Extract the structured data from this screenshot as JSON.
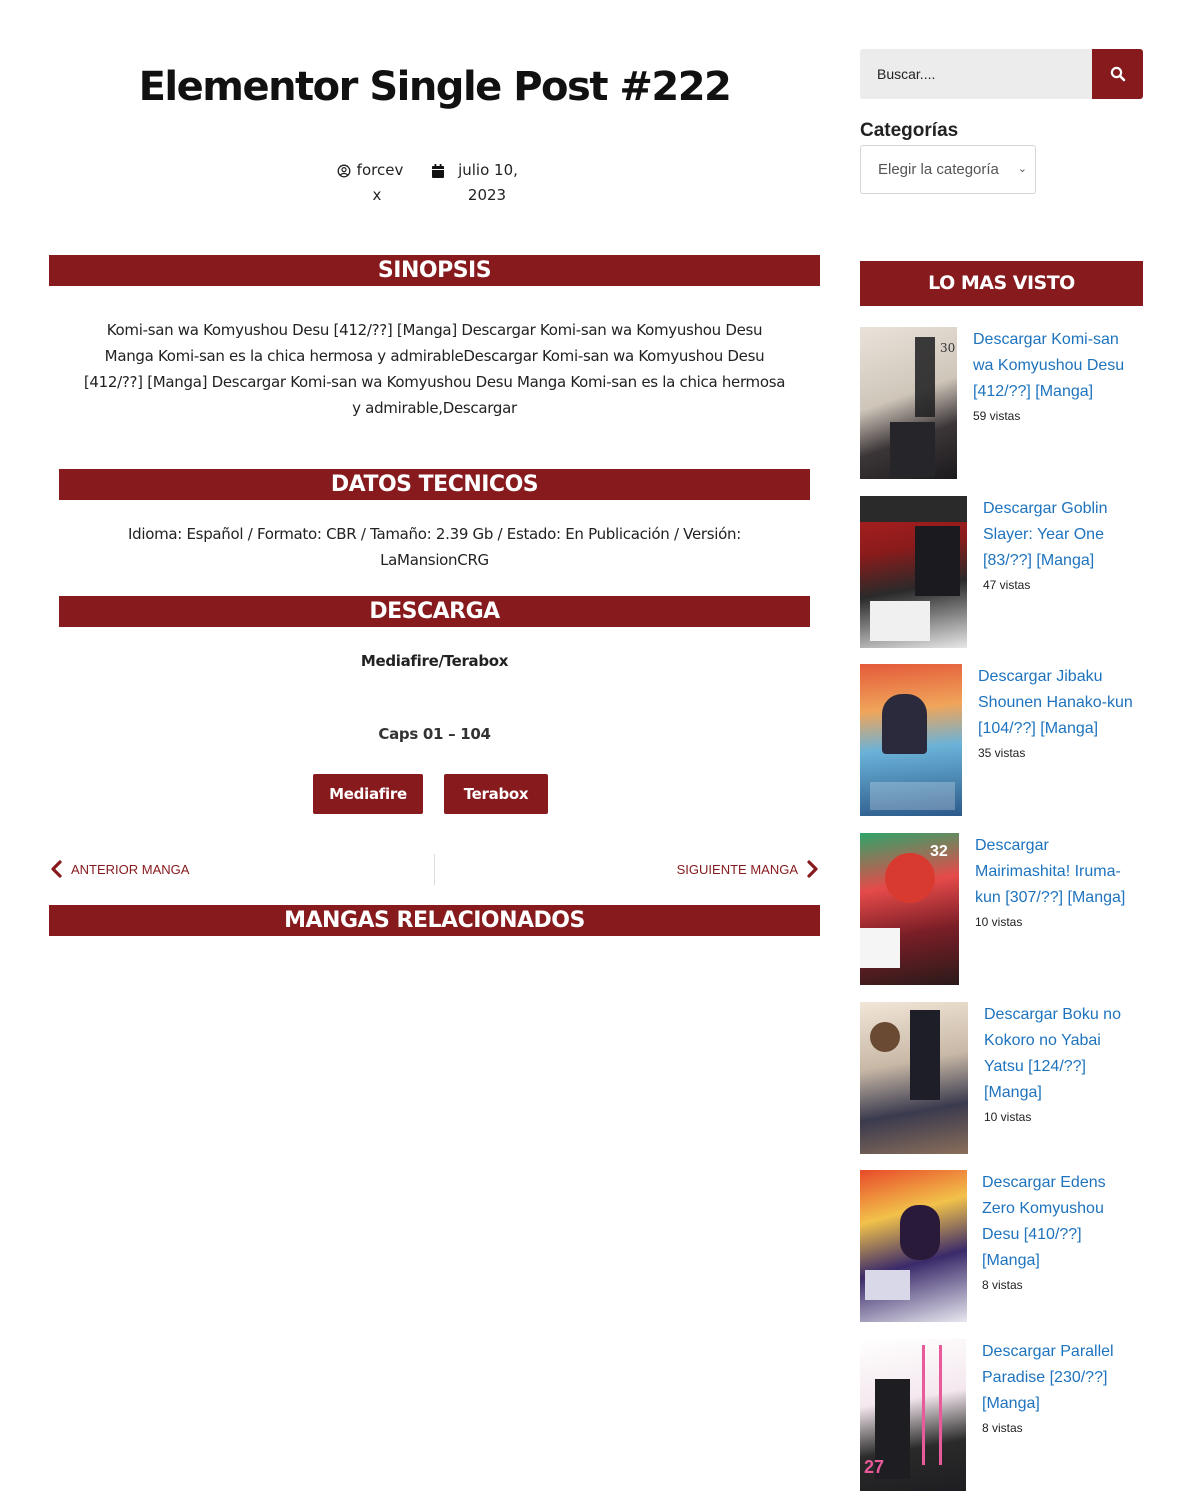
{
  "post": {
    "title": "Elementor Single Post #222",
    "author_line1": "forcev",
    "author_line2": "x",
    "date_line1": "julio 10,",
    "date_line2": "2023"
  },
  "sections": {
    "sinopsis": {
      "heading": "SINOPSIS",
      "lines": [
        "Komi-san wa Komyushou Desu [412/??] [Manga] Descargar Komi-san wa Komyushou Desu",
        "Manga Komi-san es la chica hermosa y admirableDescargar Komi-san wa Komyushou Desu",
        "[412/??] [Manga] Descargar Komi-san wa Komyushou Desu Manga Komi-san es la chica hermosa",
        "y admirable,Descargar"
      ]
    },
    "datos": {
      "heading": "DATOS TECNICOS",
      "lines": [
        "Idioma: Español / Formato: CBR / Tamaño: 2.39 Gb / Estado: En Publicación / Versión:",
        "LaMansionCRG"
      ]
    },
    "descarga": {
      "heading": "DESCARGA",
      "hosts": "Mediafire/Terabox",
      "caps": "Caps 01 – 104",
      "button_mediafire": "Mediafire",
      "button_terabox": "Terabox"
    },
    "relacionados": {
      "heading": "MANGAS RELACIONADOS"
    }
  },
  "post_nav": {
    "prev_label": "ANTERIOR MANGA",
    "next_label": "SIGUIENTE MANGA"
  },
  "sidebar": {
    "search_placeholder": "Buscar....",
    "categories_title": "Categorías",
    "categories_selected": "Elegir la categoría",
    "most_viewed_heading": "LO MAS VISTO",
    "items": [
      {
        "title_lines": [
          "Descargar Komi-san",
          "wa Komyushou Desu",
          "[412/??] [Manga]"
        ],
        "views": "59 vistas"
      },
      {
        "title_lines": [
          "Descargar Goblin",
          "Slayer: Year One",
          "[83/??] [Manga]"
        ],
        "views": "47 vistas"
      },
      {
        "title_lines": [
          "Descargar Jibaku",
          "Shounen Hanako-kun",
          "[104/??] [Manga]"
        ],
        "views": "35 vistas"
      },
      {
        "title_lines": [
          "Descargar",
          "Mairimashita! Iruma-",
          "kun [307/??] [Manga]"
        ],
        "views": "10 vistas"
      },
      {
        "title_lines": [
          "Descargar Boku no",
          "Kokoro no Yabai",
          "Yatsu [124/??]",
          "[Manga]"
        ],
        "views": "10 vistas"
      },
      {
        "title_lines": [
          "Descargar Edens",
          "Zero Komyushou",
          "Desu [410/??]",
          "[Manga]"
        ],
        "views": "8 vistas"
      },
      {
        "title_lines": [
          "Descargar Parallel",
          "Paradise [230/??]",
          "[Manga]"
        ],
        "views": "8 vistas"
      }
    ]
  },
  "colors": {
    "accent": "#861a1d",
    "link": "#1e73be"
  }
}
